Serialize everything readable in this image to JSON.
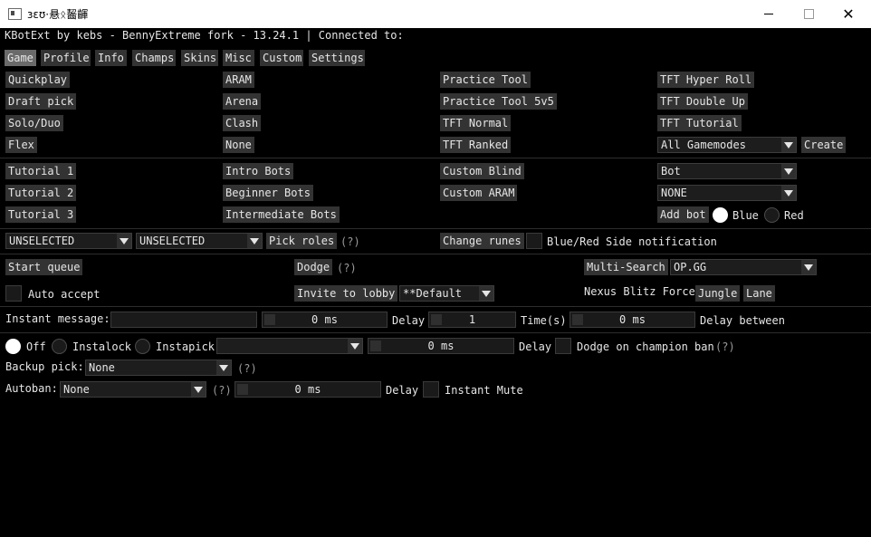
{
  "window": {
    "title": "ɜɛʊ·悬ᛟ齧齳",
    "close_glyph": "✕"
  },
  "header": {
    "status": "KBotExt by kebs - BennyExtreme fork - 13.24.1 | Connected to:"
  },
  "tabs": [
    "Game",
    "Profile",
    "Info",
    "Champs",
    "Skins",
    "Misc",
    "Custom",
    "Settings"
  ],
  "active_tab": "Game",
  "queues": {
    "col1": [
      "Quickplay",
      "Draft pick",
      "Solo/Duo",
      "Flex"
    ],
    "col2": [
      "ARAM",
      "Arena",
      "Clash",
      "None"
    ],
    "col3": [
      "Practice Tool",
      "Practice Tool 5v5",
      "TFT Normal",
      "TFT Ranked"
    ],
    "col4": [
      "TFT Hyper Roll",
      "TFT Double Up",
      "TFT Tutorial"
    ],
    "gamemode_select": "All Gamemodes",
    "create_label": "Create"
  },
  "custom": {
    "col1": [
      "Tutorial 1",
      "Tutorial 2",
      "Tutorial 3"
    ],
    "col2": [
      "Intro Bots",
      "Beginner Bots",
      "Intermediate Bots"
    ],
    "col3": [
      "Custom Blind",
      "Custom ARAM"
    ],
    "bot_select": "Bot",
    "champ_select": "NONE",
    "add_bot_label": "Add bot",
    "blue_label": "Blue",
    "red_label": "Red",
    "team_selected": "Blue"
  },
  "roles": {
    "role1": "UNSELECTED",
    "role2": "UNSELECTED",
    "pick_roles_label": "Pick roles",
    "help": "(?)",
    "change_runes_label": "Change runes",
    "side_notification_label": "Blue/Red Side notification"
  },
  "lobby": {
    "start_queue_label": "Start queue",
    "dodge_label": "Dodge",
    "help": "(?)",
    "multi_search_label": "Multi-Search",
    "multi_search_site": "OP.GG",
    "auto_accept_label": "Auto accept",
    "invite_label": "Invite to lobby",
    "invite_select": "**Default",
    "nexus_label": "Nexus Blitz Force",
    "jungle_label": "Jungle",
    "lane_label": "Lane"
  },
  "instant_message": {
    "label": "Instant message:",
    "value": "",
    "delay_value": "0 ms",
    "delay_label": "Delay",
    "times_value": "1",
    "times_label": "Time(s)",
    "between_value": "0 ms",
    "between_label": "Delay between"
  },
  "instalock": {
    "off_label": "Off",
    "instalock_label": "Instalock",
    "instapick_label": "Instapick",
    "mode_selected": "Off",
    "champ_select": "",
    "delay_value": "0 ms",
    "delay_label": "Delay",
    "dodge_ban_label": "Dodge on champion ban",
    "help": "(?)"
  },
  "backup_pick": {
    "label": "Backup pick:",
    "value": "None",
    "help": "(?)"
  },
  "autoban": {
    "label": "Autoban:",
    "value": "None",
    "help": "(?)",
    "delay_value": "0 ms",
    "delay_label": "Delay",
    "mute_label": "Instant Mute"
  }
}
